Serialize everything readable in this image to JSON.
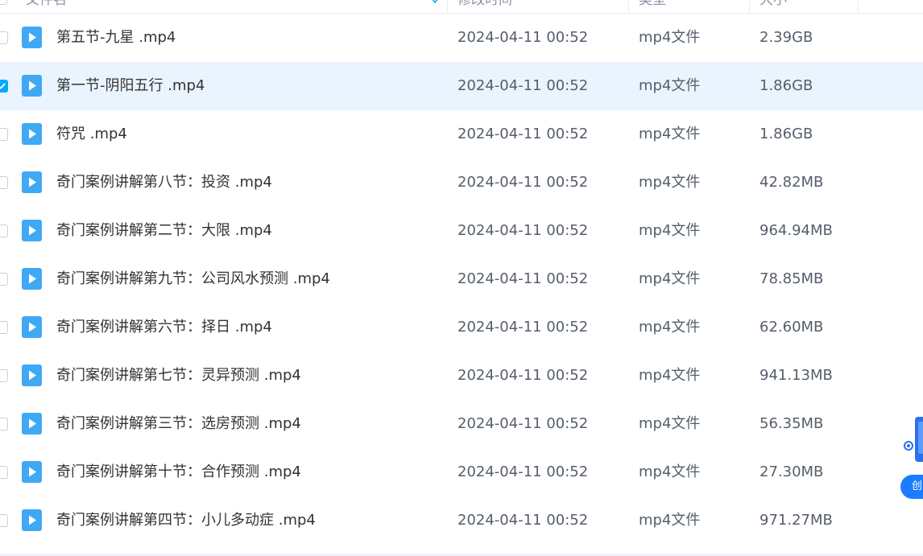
{
  "header": {
    "columns": [
      {
        "label": "文件名"
      },
      {
        "label": "修改时间"
      },
      {
        "label": "类型"
      },
      {
        "label": "大小"
      }
    ]
  },
  "files": [
    {
      "name": "第五节-九星 .mp4",
      "date": "2024-04-11 00:52",
      "type": "mp4文件",
      "size": "2.39GB",
      "selected": false
    },
    {
      "name": "第一节-阴阳五行 .mp4",
      "date": "2024-04-11 00:52",
      "type": "mp4文件",
      "size": "1.86GB",
      "selected": true
    },
    {
      "name": "符咒 .mp4",
      "date": "2024-04-11 00:52",
      "type": "mp4文件",
      "size": "1.86GB",
      "selected": false
    },
    {
      "name": "奇门案例讲解第八节：投资 .mp4",
      "date": "2024-04-11 00:52",
      "type": "mp4文件",
      "size": "42.82MB",
      "selected": false
    },
    {
      "name": "奇门案例讲解第二节：大限 .mp4",
      "date": "2024-04-11 00:52",
      "type": "mp4文件",
      "size": "964.94MB",
      "selected": false
    },
    {
      "name": "奇门案例讲解第九节：公司风水预测 .mp4",
      "date": "2024-04-11 00:52",
      "type": "mp4文件",
      "size": "78.85MB",
      "selected": false
    },
    {
      "name": "奇门案例讲解第六节：择日 .mp4",
      "date": "2024-04-11 00:52",
      "type": "mp4文件",
      "size": "62.60MB",
      "selected": false
    },
    {
      "name": "奇门案例讲解第七节：灵异预测 .mp4",
      "date": "2024-04-11 00:52",
      "type": "mp4文件",
      "size": "941.13MB",
      "selected": false
    },
    {
      "name": "奇门案例讲解第三节：选房预测 .mp4",
      "date": "2024-04-11 00:52",
      "type": "mp4文件",
      "size": "56.35MB",
      "selected": false
    },
    {
      "name": "奇门案例讲解第十节：合作预测 .mp4",
      "date": "2024-04-11 00:52",
      "type": "mp4文件",
      "size": "27.30MB",
      "selected": false
    },
    {
      "name": "奇门案例讲解第四节：小儿多动症 .mp4",
      "date": "2024-04-11 00:52",
      "type": "mp4文件",
      "size": "971.27MB",
      "selected": false
    }
  ],
  "float_widget": {
    "button_label": "创"
  },
  "colors": {
    "accent": "#06a7ff",
    "selected_row": "#eaf4fe",
    "file_icon": "#3fa9f5"
  },
  "icons": {
    "file": "video-file-icon",
    "sort": "sort-arrow-icon",
    "check": "check-icon"
  }
}
